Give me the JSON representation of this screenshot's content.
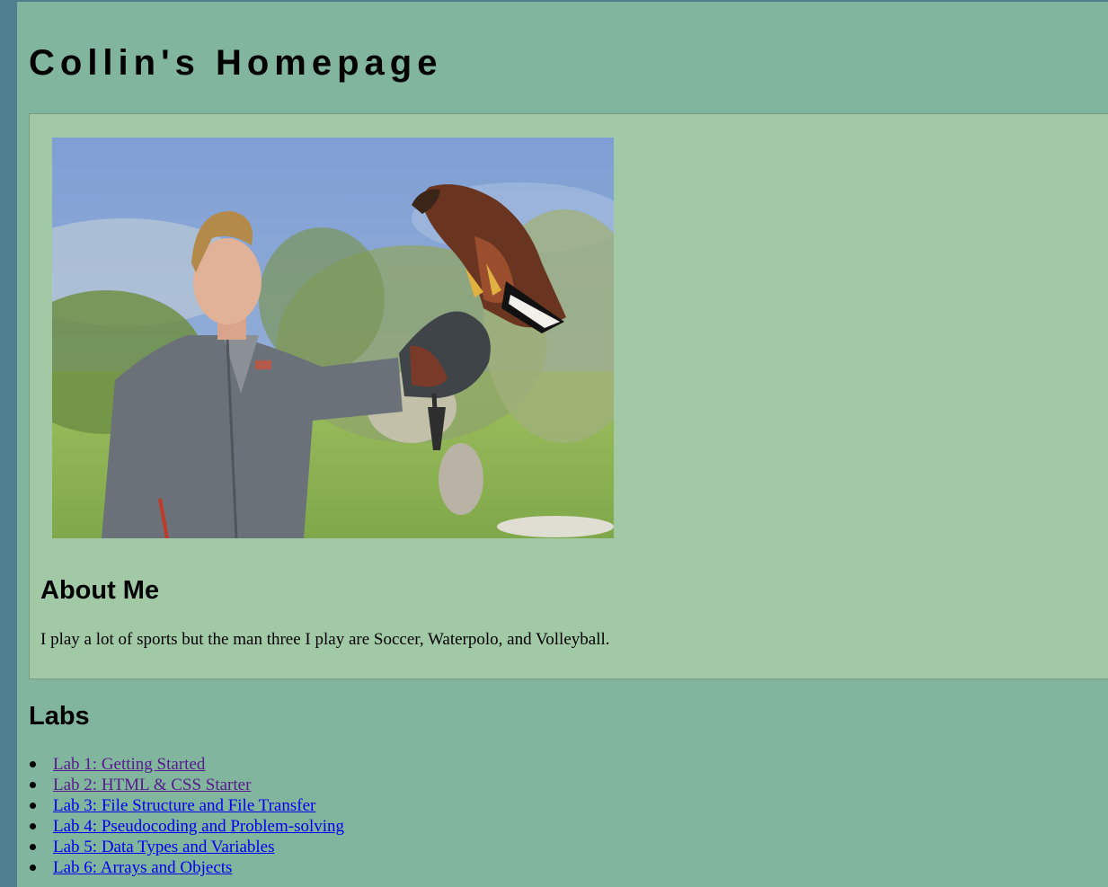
{
  "header": {
    "title": "Collin's Homepage"
  },
  "about": {
    "photo_icon": "profile-photo",
    "heading": "About Me",
    "text": "I play a lot of sports but the man three I play are Soccer, Waterpolo, and Volleyball."
  },
  "labs": {
    "heading": "Labs",
    "items": [
      {
        "label": "Lab 1: Getting Started",
        "visited": true
      },
      {
        "label": "Lab 2: HTML & CSS Starter",
        "visited": true
      },
      {
        "label": "Lab 3: File Structure and File Transfer",
        "visited": false
      },
      {
        "label": "Lab 4: Pseudocoding and Problem-solving",
        "visited": false
      },
      {
        "label": "Lab 5: Data Types and Variables",
        "visited": false
      },
      {
        "label": "Lab 6: Arrays and Objects",
        "visited": false
      }
    ]
  },
  "colors": {
    "page_background": "#82b59d",
    "panel_background": "#a2c9a6",
    "outer_background": "#4f7f8e",
    "link": "#0000ee",
    "visited_link": "#551a8b"
  }
}
